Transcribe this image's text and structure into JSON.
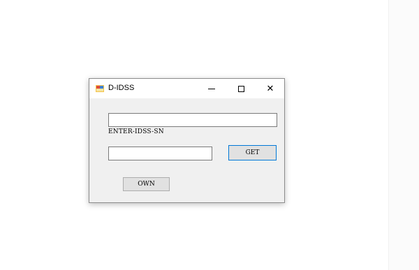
{
  "window": {
    "title": "D-IDSS",
    "minimize_label": "",
    "maximize_label": "",
    "close_label": "✕"
  },
  "form": {
    "top_input_value": "",
    "label": "ENTER-IDSS-SN",
    "bottom_input_value": "",
    "get_button": "GET",
    "own_button": "OWN"
  },
  "colors": {
    "window_bg": "#f0f0f0",
    "focus_border": "#0078d7"
  }
}
